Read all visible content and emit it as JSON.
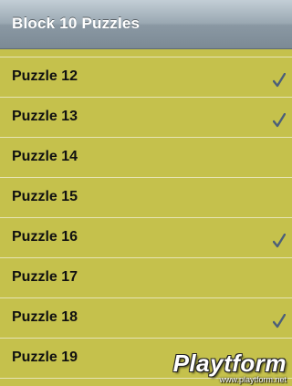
{
  "navbar": {
    "title": "Block 10 Puzzles"
  },
  "puzzles": [
    {
      "label": "Puzzle 12",
      "completed": true
    },
    {
      "label": "Puzzle 13",
      "completed": true
    },
    {
      "label": "Puzzle 14",
      "completed": false
    },
    {
      "label": "Puzzle 15",
      "completed": false
    },
    {
      "label": "Puzzle 16",
      "completed": true
    },
    {
      "label": "Puzzle 17",
      "completed": false
    },
    {
      "label": "Puzzle 18",
      "completed": true
    },
    {
      "label": "Puzzle 19",
      "completed": false
    }
  ],
  "watermark": {
    "logo": "Playtform",
    "url": "www.playtform.net"
  },
  "colors": {
    "row_bg": "#c5c14c",
    "separator": "#e6e4b4",
    "checkmark": "#4b5f7a"
  },
  "icons": {
    "checkmark": "checkmark-icon"
  }
}
